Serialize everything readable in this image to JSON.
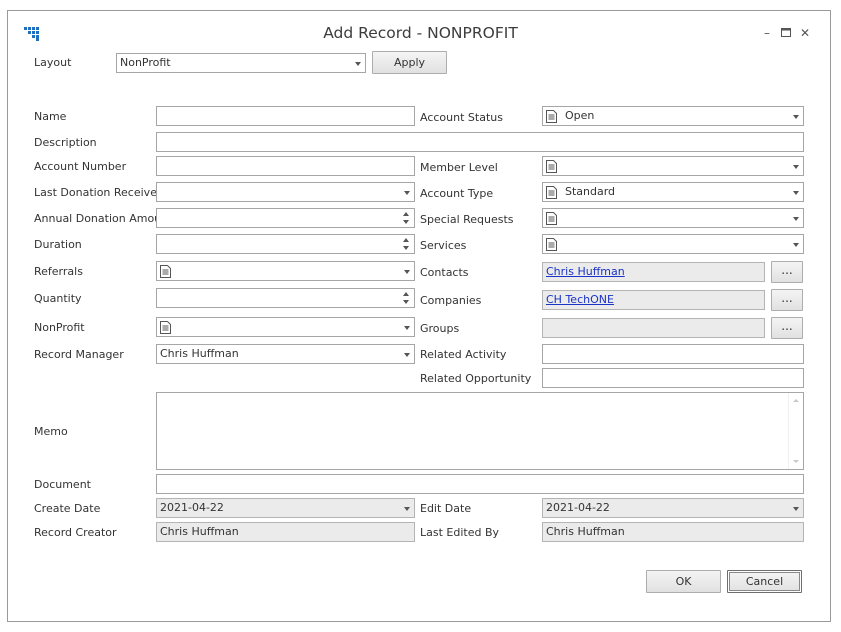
{
  "window": {
    "title": "Add Record - NONPROFIT",
    "icons": {
      "app": "grid-app-icon",
      "minimize": "minimize-icon",
      "maximize": "maximize-icon",
      "close": "close-icon"
    }
  },
  "layout_bar": {
    "label": "Layout",
    "value": "NonProfit",
    "apply_label": "Apply"
  },
  "left": {
    "name": {
      "label": "Name",
      "value": ""
    },
    "description": {
      "label": "Description",
      "value": ""
    },
    "account_number": {
      "label": "Account Number",
      "value": ""
    },
    "last_donation_received": {
      "label": "Last Donation Received",
      "value": ""
    },
    "annual_donation_amount": {
      "label": "Annual Donation Amount",
      "value": ""
    },
    "duration": {
      "label": "Duration",
      "value": ""
    },
    "referrals": {
      "label": "Referrals",
      "value": ""
    },
    "quantity": {
      "label": "Quantity",
      "value": ""
    },
    "nonprofit": {
      "label": "NonProfit",
      "value": ""
    },
    "record_manager": {
      "label": "Record Manager",
      "value": "Chris Huffman"
    },
    "memo": {
      "label": "Memo",
      "value": ""
    },
    "document": {
      "label": "Document",
      "value": ""
    },
    "create_date": {
      "label": "Create Date",
      "value": "2021-04-22"
    },
    "record_creator": {
      "label": "Record Creator",
      "value": "Chris Huffman"
    }
  },
  "right": {
    "account_status": {
      "label": "Account Status",
      "value": "Open"
    },
    "member_level": {
      "label": "Member Level",
      "value": ""
    },
    "account_type": {
      "label": "Account Type",
      "value": "Standard"
    },
    "special_requests": {
      "label": "Special Requests",
      "value": ""
    },
    "services": {
      "label": "Services",
      "value": ""
    },
    "contacts": {
      "label": "Contacts",
      "value": "Chris Huffman",
      "browse": "..."
    },
    "companies": {
      "label": "Companies",
      "value": "CH TechONE",
      "browse": "..."
    },
    "groups": {
      "label": "Groups",
      "value": "",
      "browse": "..."
    },
    "related_activity": {
      "label": "Related Activity",
      "value": ""
    },
    "related_opportunity": {
      "label": "Related Opportunity",
      "value": ""
    },
    "edit_date": {
      "label": "Edit Date",
      "value": "2021-04-22"
    },
    "last_edited_by": {
      "label": "Last Edited By",
      "value": "Chris Huffman"
    }
  },
  "footer": {
    "ok_label": "OK",
    "cancel_label": "Cancel"
  },
  "colors": {
    "link": "#1a33c8",
    "readonly_bg": "#ebebeb",
    "app_icon": "#1e6fbf"
  }
}
